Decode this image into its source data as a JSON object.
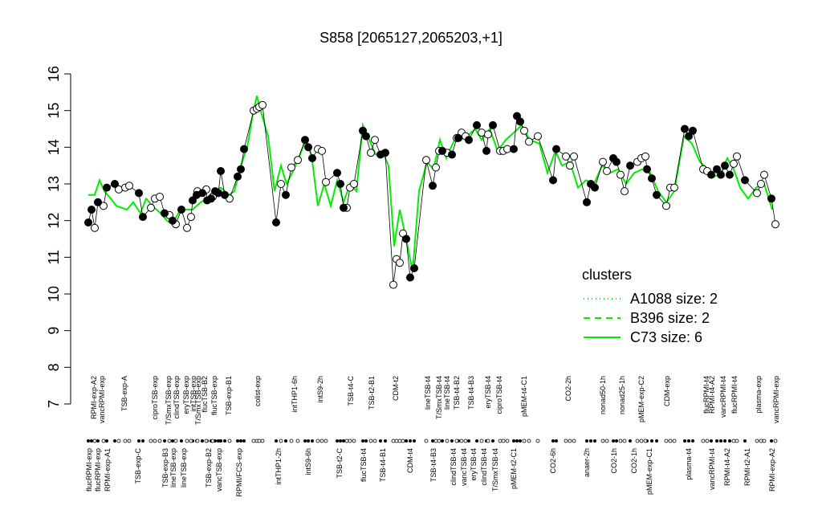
{
  "chart_data": {
    "type": "scatter",
    "title": "S858 [2065127,2065203,+1]",
    "xlabel": "",
    "ylabel": "",
    "ylim": [
      7,
      16
    ],
    "yticks": [
      7,
      8,
      9,
      10,
      11,
      12,
      13,
      14,
      15,
      16
    ],
    "grid": false,
    "legend": {
      "title": "clusters",
      "placement": "right",
      "entries": [
        {
          "label": "A1088 size: 2",
          "style": "dotted",
          "color": "#00ee00"
        },
        {
          "label": "B396 size: 2",
          "style": "dashed",
          "color": "#00ee00"
        },
        {
          "label": "C73 size: 6",
          "style": "solid",
          "color": "#00ee00"
        }
      ]
    },
    "colors": {
      "line": "#00ee00",
      "points": "#000000",
      "open_fill": "#ffffff"
    },
    "x_labels_top": [
      {
        "label": "RPMI-exp-A2",
        "x": 117
      },
      {
        "label": "vancRPMI-exp",
        "x": 127
      },
      {
        "label": "TSB-exp-A",
        "x": 155
      },
      {
        "label": "ciproTSB-exp",
        "x": 193
      },
      {
        "label": "T/SmxTSB-exp",
        "x": 210
      },
      {
        "label": "clindTSB-exp",
        "x": 220
      },
      {
        "label": "eryTSB-exp",
        "x": 232
      },
      {
        "label": "intTSB-exp",
        "x": 241
      },
      {
        "label": "T/SmxTSB-exp",
        "x": 247
      },
      {
        "label": "flucTSB-B2",
        "x": 255
      },
      {
        "label": "flucTSB-exp",
        "x": 267
      },
      {
        "label": "TSB-exp-B1",
        "x": 285
      },
      {
        "label": "colist-exp",
        "x": 321
      },
      {
        "label": "intTHP1-6h",
        "x": 367
      },
      {
        "label": "intS9-2h",
        "x": 399
      },
      {
        "label": "TSB-t4-C",
        "x": 437
      },
      {
        "label": "TSB-t2-B1",
        "x": 463
      },
      {
        "label": "CDM-t2",
        "x": 493
      },
      {
        "label": "lineTSB-t4",
        "x": 533
      },
      {
        "label": "T/SmxTSB-t4",
        "x": 547
      },
      {
        "label": "lineTSB-t4",
        "x": 557
      },
      {
        "label": "TSB-t4-B2",
        "x": 569
      },
      {
        "label": "TSB-t4-B3",
        "x": 587
      },
      {
        "label": "eryTSB-t4",
        "x": 608
      },
      {
        "label": "ciproTSB-t4",
        "x": 622
      },
      {
        "label": "pMEM-t4-C1",
        "x": 653
      },
      {
        "label": "CO2-2h",
        "x": 708
      },
      {
        "label": "nonad50-1h",
        "x": 751
      },
      {
        "label": "nonad25-1h",
        "x": 775
      },
      {
        "label": "pMEM-exp-C2",
        "x": 799
      },
      {
        "label": "CDM-exp",
        "x": 831
      },
      {
        "label": "flucRPMI-t4",
        "x": 880
      },
      {
        "label": "RPMI-t4-A2",
        "x": 887
      },
      {
        "label": "vancRPMI-t4",
        "x": 901
      },
      {
        "label": "flucRPMI-t4",
        "x": 915
      },
      {
        "label": "plasma-exp",
        "x": 945
      },
      {
        "label": "vancRPMI-exp",
        "x": 967
      }
    ],
    "x_labels_bottom": [
      {
        "label": "flucRPMI-exp",
        "x": 111
      },
      {
        "label": "flucRPMI-exp",
        "x": 122
      },
      {
        "label": "RPMI-exp-A1",
        "x": 134
      },
      {
        "label": "TSB-exp-C",
        "x": 172
      },
      {
        "label": "TSB-exp-B3",
        "x": 206
      },
      {
        "label": "lineTSB-exp",
        "x": 216
      },
      {
        "label": "lineTSB-exp",
        "x": 229
      },
      {
        "label": "TSB-exp-B2",
        "x": 260
      },
      {
        "label": "vancTSB-exp",
        "x": 273
      },
      {
        "label": "RPMI/FCS-exp",
        "x": 298
      },
      {
        "label": "intTHP1-2h",
        "x": 347
      },
      {
        "label": "intS9-6h",
        "x": 384
      },
      {
        "label": "TSB-t2-C",
        "x": 423
      },
      {
        "label": "flucTSB-t4",
        "x": 453
      },
      {
        "label": "TSB-t4-B1",
        "x": 477
      },
      {
        "label": "CDM-t4",
        "x": 511
      },
      {
        "label": "TSB-t4-B3",
        "x": 540
      },
      {
        "label": "clindTSB-t4",
        "x": 565
      },
      {
        "label": "vancTSB-t4",
        "x": 578
      },
      {
        "label": "eryTSB-t4",
        "x": 590
      },
      {
        "label": "clindTSB-t4",
        "x": 603
      },
      {
        "label": "T/SmxTSB-t4",
        "x": 617
      },
      {
        "label": "pMEM-t2-C1",
        "x": 640
      },
      {
        "label": "CO2-6h",
        "x": 689
      },
      {
        "label": "anaer-2h",
        "x": 731
      },
      {
        "label": "CO2-1h",
        "x": 765
      },
      {
        "label": "CO2-1h",
        "x": 790
      },
      {
        "label": "pMEM-exp-C1",
        "x": 809
      },
      {
        "label": "plasma-t4",
        "x": 858
      },
      {
        "label": "vancRPMI-t4",
        "x": 887
      },
      {
        "label": "RPMI-t4-A2",
        "x": 906
      },
      {
        "label": "RPMI-t2-A1",
        "x": 931
      },
      {
        "label": "RPMI-exp-A2",
        "x": 962
      }
    ],
    "x_range": [
      100,
      970
    ],
    "series": [
      {
        "name": "C73 size: 6",
        "values": [
          [
            110,
            12.7
          ],
          [
            118,
            12.7
          ],
          [
            124,
            13.1
          ],
          [
            130,
            12.8
          ],
          [
            138,
            12.6
          ],
          [
            145,
            12.4
          ],
          [
            158,
            12.3
          ],
          [
            166,
            12.5
          ],
          [
            175,
            12.2
          ],
          [
            182,
            12.6
          ],
          [
            190,
            12.4
          ],
          [
            200,
            12.2
          ],
          [
            208,
            12.0
          ],
          [
            215,
            11.9
          ],
          [
            222,
            12.2
          ],
          [
            230,
            12.3
          ],
          [
            240,
            12.3
          ],
          [
            250,
            12.5
          ],
          [
            258,
            12.6
          ],
          [
            266,
            12.8
          ],
          [
            275,
            12.9
          ],
          [
            285,
            12.7
          ],
          [
            292,
            12.8
          ],
          [
            300,
            13.5
          ],
          [
            308,
            14.0
          ],
          [
            315,
            14.9
          ],
          [
            320,
            15.4
          ],
          [
            326,
            14.9
          ],
          [
            334,
            14.3
          ],
          [
            342,
            12.8
          ],
          [
            350,
            13.5
          ],
          [
            357,
            13.0
          ],
          [
            364,
            13.3
          ],
          [
            372,
            13.7
          ],
          [
            381,
            14.2
          ],
          [
            388,
            13.8
          ],
          [
            396,
            12.4
          ],
          [
            404,
            13.0
          ],
          [
            412,
            12.4
          ],
          [
            420,
            13.1
          ],
          [
            428,
            12.5
          ],
          [
            436,
            13.0
          ],
          [
            444,
            12.8
          ],
          [
            452,
            14.6
          ],
          [
            460,
            14.2
          ],
          [
            468,
            13.8
          ],
          [
            476,
            13.9
          ],
          [
            484,
            13.5
          ],
          [
            491,
            11.3
          ],
          [
            498,
            12.3
          ],
          [
            506,
            11.5
          ],
          [
            514,
            10.6
          ],
          [
            522,
            12.8
          ],
          [
            532,
            13.6
          ],
          [
            540,
            13.4
          ],
          [
            548,
            14.2
          ],
          [
            556,
            13.7
          ],
          [
            564,
            14.1
          ],
          [
            572,
            14.4
          ],
          [
            582,
            14.3
          ],
          [
            592,
            14.5
          ],
          [
            600,
            14.2
          ],
          [
            610,
            14.5
          ],
          [
            620,
            13.9
          ],
          [
            630,
            14.2
          ],
          [
            640,
            14.4
          ],
          [
            650,
            14.6
          ],
          [
            660,
            14.2
          ],
          [
            672,
            14.1
          ],
          [
            682,
            13.3
          ],
          [
            692,
            13.9
          ],
          [
            700,
            13.5
          ],
          [
            710,
            13.6
          ],
          [
            720,
            12.9
          ],
          [
            730,
            13.1
          ],
          [
            740,
            13.0
          ],
          [
            750,
            13.5
          ],
          [
            760,
            13.3
          ],
          [
            770,
            13.4
          ],
          [
            780,
            13.0
          ],
          [
            790,
            13.3
          ],
          [
            800,
            13.4
          ],
          [
            810,
            13.3
          ],
          [
            820,
            12.8
          ],
          [
            830,
            12.5
          ],
          [
            840,
            12.8
          ],
          [
            852,
            14.3
          ],
          [
            862,
            14.1
          ],
          [
            872,
            13.6
          ],
          [
            882,
            13.4
          ],
          [
            890,
            13.2
          ],
          [
            898,
            13.3
          ],
          [
            906,
            13.7
          ],
          [
            914,
            13.4
          ],
          [
            922,
            12.9
          ],
          [
            932,
            12.6
          ],
          [
            942,
            12.9
          ],
          [
            952,
            13.0
          ],
          [
            962,
            12.3
          ]
        ]
      }
    ],
    "points_closed": [
      [
        110,
        11.95
      ],
      [
        114,
        12.3
      ],
      [
        122,
        12.5
      ],
      [
        133,
        12.9
      ],
      [
        143,
        13.0
      ],
      [
        173,
        12.75
      ],
      [
        178,
        12.1
      ],
      [
        205,
        12.2
      ],
      [
        215,
        12.0
      ],
      [
        226,
        12.3
      ],
      [
        240,
        12.55
      ],
      [
        245,
        12.7
      ],
      [
        252,
        12.75
      ],
      [
        258,
        12.55
      ],
      [
        263,
        12.6
      ],
      [
        268,
        12.8
      ],
      [
        272,
        12.75
      ],
      [
        275,
        13.35
      ],
      [
        280,
        12.7
      ],
      [
        296,
        13.2
      ],
      [
        300,
        13.4
      ],
      [
        304,
        13.95
      ],
      [
        344,
        11.95
      ],
      [
        356,
        12.7
      ],
      [
        380,
        14.2
      ],
      [
        384,
        14.0
      ],
      [
        389,
        13.7
      ],
      [
        420,
        13.3
      ],
      [
        424,
        13.0
      ],
      [
        428,
        12.35
      ],
      [
        452,
        14.45
      ],
      [
        456,
        14.3
      ],
      [
        474,
        13.8
      ],
      [
        480,
        13.85
      ],
      [
        506,
        11.5
      ],
      [
        511,
        10.45
      ],
      [
        516,
        10.7
      ],
      [
        539,
        12.95
      ],
      [
        551,
        13.9
      ],
      [
        563,
        13.8
      ],
      [
        571,
        14.25
      ],
      [
        584,
        14.2
      ],
      [
        594,
        14.6
      ],
      [
        606,
        13.9
      ],
      [
        614,
        14.6
      ],
      [
        640,
        13.95
      ],
      [
        644,
        14.85
      ],
      [
        648,
        14.7
      ],
      [
        689,
        13.1
      ],
      [
        693,
        13.95
      ],
      [
        731,
        12.5
      ],
      [
        736,
        13.0
      ],
      [
        741,
        12.9
      ],
      [
        764,
        13.7
      ],
      [
        768,
        13.6
      ],
      [
        785,
        13.5
      ],
      [
        806,
        13.4
      ],
      [
        812,
        13.15
      ],
      [
        818,
        12.7
      ],
      [
        853,
        14.5
      ],
      [
        858,
        14.3
      ],
      [
        863,
        14.45
      ],
      [
        886,
        13.25
      ],
      [
        893,
        13.4
      ],
      [
        898,
        13.25
      ],
      [
        903,
        13.5
      ],
      [
        909,
        13.25
      ],
      [
        928,
        13.1
      ],
      [
        961,
        12.6
      ]
    ],
    "points_open": [
      [
        118,
        11.8
      ],
      [
        129,
        12.4
      ],
      [
        148,
        12.85
      ],
      [
        156,
        12.9
      ],
      [
        161,
        12.95
      ],
      [
        188,
        12.35
      ],
      [
        193,
        12.6
      ],
      [
        199,
        12.65
      ],
      [
        211,
        12.15
      ],
      [
        219,
        11.9
      ],
      [
        233,
        11.8
      ],
      [
        238,
        12.1
      ],
      [
        246,
        12.8
      ],
      [
        257,
        12.85
      ],
      [
        265,
        12.65
      ],
      [
        286,
        12.6
      ],
      [
        316,
        15.0
      ],
      [
        320,
        15.05
      ],
      [
        323,
        15.1
      ],
      [
        327,
        15.15
      ],
      [
        350,
        13.0
      ],
      [
        363,
        13.45
      ],
      [
        371,
        13.65
      ],
      [
        396,
        13.95
      ],
      [
        401,
        13.9
      ],
      [
        406,
        13.05
      ],
      [
        432,
        12.35
      ],
      [
        436,
        12.9
      ],
      [
        441,
        13.0
      ],
      [
        462,
        13.85
      ],
      [
        467,
        14.2
      ],
      [
        490,
        10.25
      ],
      [
        494,
        10.95
      ],
      [
        498,
        10.85
      ],
      [
        502,
        11.65
      ],
      [
        531,
        13.65
      ],
      [
        543,
        13.45
      ],
      [
        547,
        13.9
      ],
      [
        557,
        13.85
      ],
      [
        569,
        14.25
      ],
      [
        575,
        14.4
      ],
      [
        580,
        14.3
      ],
      [
        600,
        14.4
      ],
      [
        608,
        14.35
      ],
      [
        623,
        13.9
      ],
      [
        627,
        13.9
      ],
      [
        632,
        13.95
      ],
      [
        653,
        14.45
      ],
      [
        659,
        14.15
      ],
      [
        670,
        14.3
      ],
      [
        705,
        13.75
      ],
      [
        710,
        13.5
      ],
      [
        715,
        13.75
      ],
      [
        751,
        13.6
      ],
      [
        756,
        13.35
      ],
      [
        773,
        13.25
      ],
      [
        778,
        12.8
      ],
      [
        794,
        13.6
      ],
      [
        799,
        13.7
      ],
      [
        804,
        13.75
      ],
      [
        830,
        12.4
      ],
      [
        835,
        12.9
      ],
      [
        840,
        12.9
      ],
      [
        876,
        13.4
      ],
      [
        881,
        13.35
      ],
      [
        914,
        13.55
      ],
      [
        918,
        13.75
      ],
      [
        943,
        12.75
      ],
      [
        948,
        13.0
      ],
      [
        952,
        13.25
      ],
      [
        966,
        11.9
      ]
    ]
  }
}
